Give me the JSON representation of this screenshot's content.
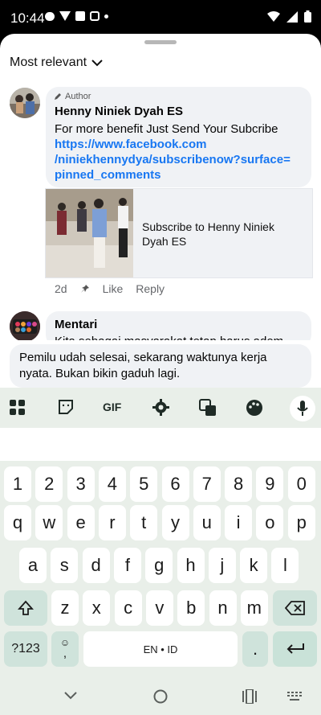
{
  "status": {
    "time": "10:44"
  },
  "sort": {
    "label": "Most relevant"
  },
  "comment1": {
    "author_tag": "Author",
    "name": "Henny Niniek Dyah ES",
    "text": "For more benefit Just Send Your Subcribe",
    "link_line1": "https://www.facebook.com",
    "link_line2": "/niniekhennydya/subscribenow?surface=",
    "link_line3": "pinned_comments",
    "preview_title": "Subscribe to Henny Niniek Dyah ES",
    "time": "2d",
    "like": "Like",
    "reply": "Reply"
  },
  "comment2": {
    "name": "Mentari",
    "text": "Kita sebagai masyarakat tetap harus adem"
  },
  "input": {
    "text": "Pemilu udah selesai, sekarang waktunya kerja nyata. Bukan bikin gaduh lagi."
  },
  "keyboard": {
    "row_numbers": [
      "1",
      "2",
      "3",
      "4",
      "5",
      "6",
      "7",
      "8",
      "9",
      "0"
    ],
    "row1": [
      "q",
      "w",
      "e",
      "r",
      "t",
      "y",
      "u",
      "i",
      "o",
      "p"
    ],
    "row2": [
      "a",
      "s",
      "d",
      "f",
      "g",
      "h",
      "j",
      "k",
      "l"
    ],
    "row3": [
      "z",
      "x",
      "c",
      "v",
      "b",
      "n",
      "m"
    ],
    "symbols": "?123",
    "space": "EN • ID",
    "period": ".",
    "comma": ",",
    "gif": "GIF"
  }
}
